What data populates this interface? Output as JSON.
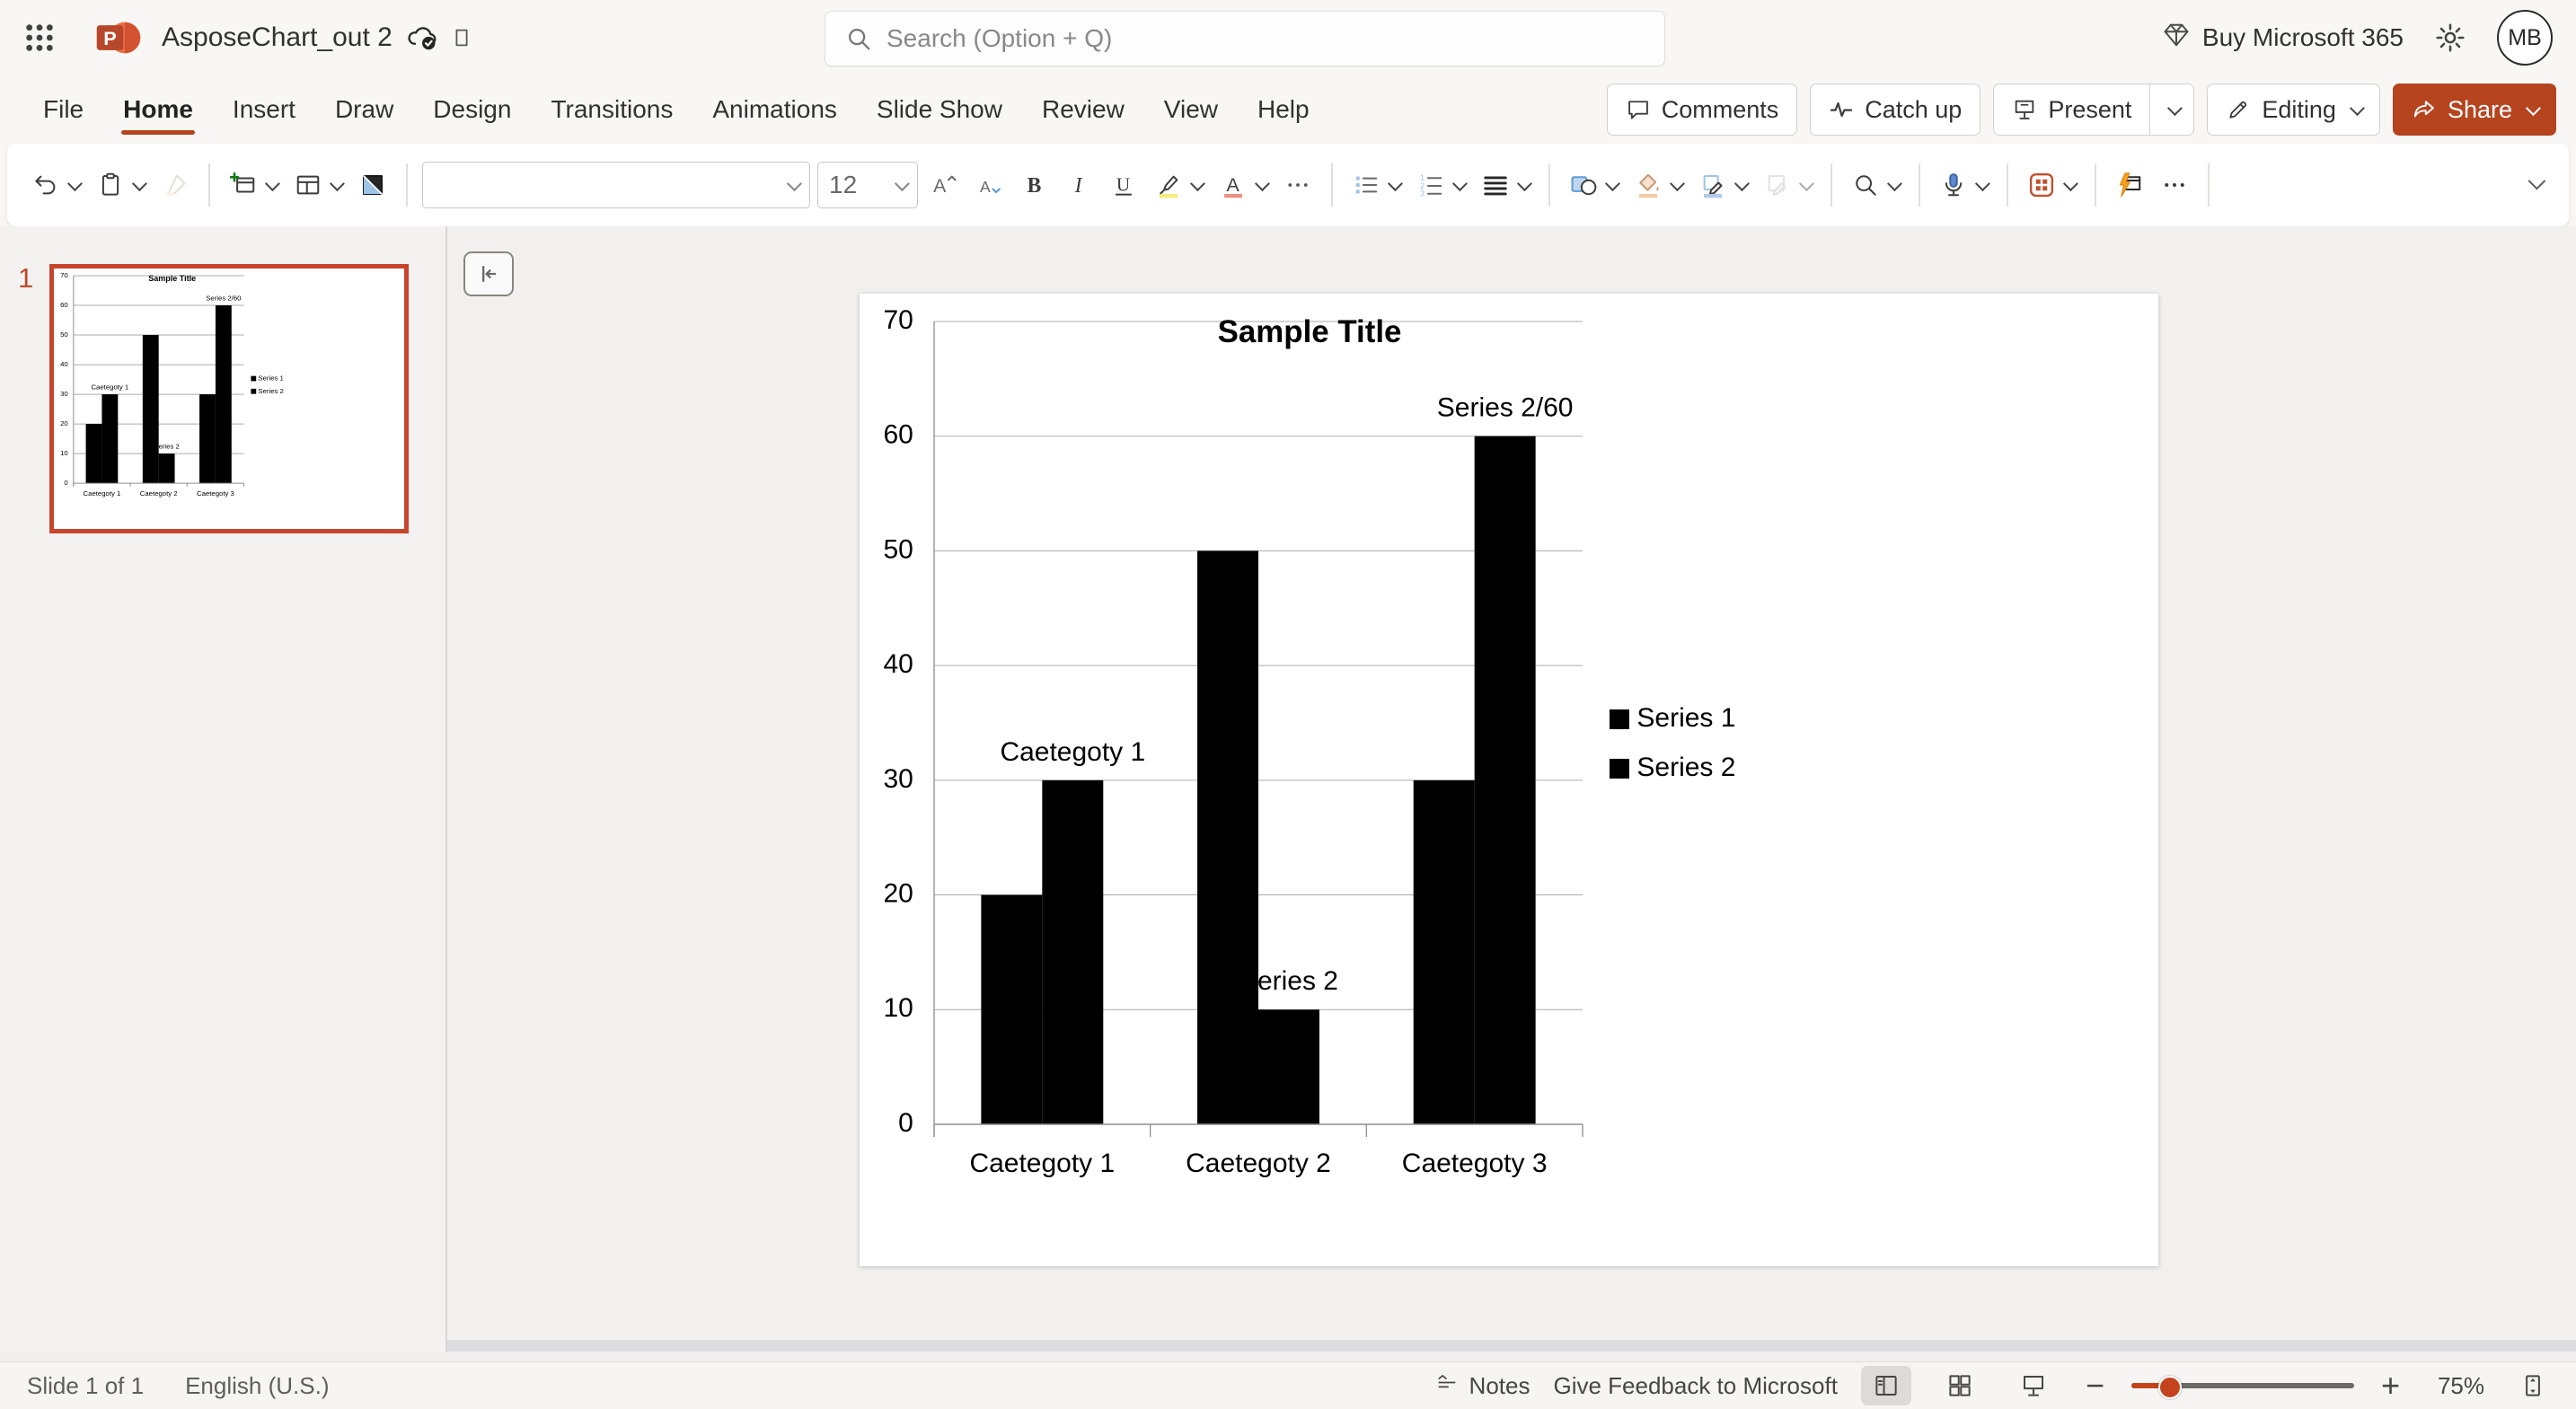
{
  "titlebar": {
    "app": "PowerPoint",
    "document_title": "AsposeChart_out 2",
    "search_placeholder": "Search (Option + Q)",
    "buy_label": "Buy Microsoft 365",
    "avatar_initials": "MB"
  },
  "menubar": {
    "items": [
      {
        "label": "File"
      },
      {
        "label": "Home",
        "active": true
      },
      {
        "label": "Insert"
      },
      {
        "label": "Draw"
      },
      {
        "label": "Design"
      },
      {
        "label": "Transitions"
      },
      {
        "label": "Animations"
      },
      {
        "label": "Slide Show"
      },
      {
        "label": "Review"
      },
      {
        "label": "View"
      },
      {
        "label": "Help"
      }
    ]
  },
  "actions": {
    "buttons": [
      {
        "id": "comments",
        "label": "Comments",
        "icon": "comments"
      },
      {
        "id": "catch-up",
        "label": "Catch up",
        "icon": "catch-up"
      },
      {
        "id": "present",
        "label": "Present",
        "icon": "present",
        "chevron": true,
        "split": true
      },
      {
        "id": "editing",
        "label": "Editing",
        "icon": "editing",
        "chevron": true
      },
      {
        "id": "share",
        "label": "Share",
        "icon": "share",
        "chevron": true,
        "primary": true
      }
    ]
  },
  "toolbar": {
    "font_size": "12",
    "items": [
      {
        "icon": "undo",
        "chevron": true
      },
      {
        "icon": "paste",
        "chevron": true
      },
      {
        "icon": "format-painter",
        "disabled": true
      },
      {
        "divider": true
      },
      {
        "icon": "new-slide",
        "chevron": true
      },
      {
        "icon": "layout",
        "chevron": true
      },
      {
        "icon": "reset-design"
      },
      {
        "divider": true
      },
      {
        "combo": "font-name",
        "chevron": true
      },
      {
        "combo": "font-size",
        "chevron": true
      },
      {
        "icon": "grow-font"
      },
      {
        "icon": "shrink-font"
      },
      {
        "icon": "bold"
      },
      {
        "icon": "italic"
      },
      {
        "icon": "underline"
      },
      {
        "icon": "text-highlight",
        "chevron": true
      },
      {
        "icon": "font-color",
        "chevron": true
      },
      {
        "icon": "more-commands"
      },
      {
        "divider": true
      },
      {
        "icon": "bullets",
        "chevron": true
      },
      {
        "icon": "numbering",
        "chevron": true
      },
      {
        "icon": "align",
        "chevron": true
      },
      {
        "divider": true
      },
      {
        "icon": "shapes",
        "chevron": true
      },
      {
        "icon": "shape-fill",
        "chevron": true
      },
      {
        "icon": "shape-outline",
        "chevron": true
      },
      {
        "icon": "shape-effects",
        "chevron": true,
        "disabled": true
      },
      {
        "divider": true
      },
      {
        "icon": "find",
        "chevron": true
      },
      {
        "divider": true
      },
      {
        "icon": "dictate",
        "chevron": true
      },
      {
        "divider": true
      },
      {
        "icon": "designer",
        "chevron": true
      },
      {
        "divider": true
      },
      {
        "icon": "quick-design"
      },
      {
        "icon": "overflow"
      },
      {
        "divider": true
      }
    ]
  },
  "thumbnail_panel": {
    "slide_number": "1"
  },
  "status_bar": {
    "slide_counter": "Slide 1 of 1",
    "language": "English (U.S.)",
    "notes_label": "Notes",
    "feedback_label": "Give Feedback to Microsoft",
    "zoom_level": "75%"
  },
  "chart_data": {
    "type": "bar",
    "title": "Sample Title",
    "categories": [
      "Caetegoty 1",
      "Caetegoty 2",
      "Caetegoty 3"
    ],
    "series": [
      {
        "name": "Series 1",
        "values": [
          20,
          50,
          30
        ],
        "color": "#000000"
      },
      {
        "name": "Series 2",
        "values": [
          30,
          10,
          60
        ],
        "color": "#000000"
      }
    ],
    "ylim": [
      0,
      70
    ],
    "yticks": [
      0,
      10,
      20,
      30,
      40,
      50,
      60,
      70
    ],
    "grid": true,
    "legend_position": "right",
    "legend_entries": [
      "Series 1",
      "Series 2"
    ],
    "data_labels": [
      {
        "text": "Caetegoty 1",
        "category": 0,
        "series": 1
      },
      {
        "text": "Series 2",
        "category": 1,
        "series": 1
      },
      {
        "text": "Series 2/60",
        "category": 2,
        "series": 1
      }
    ]
  },
  "colors": {
    "accent": "#B5441F",
    "selection_border": "#C8442C",
    "bar": "#000000",
    "highlight_bar": "#F4EC7A",
    "font_color_bar": "#EE8F83",
    "shape_fill_bar": "#F5C9A4",
    "shape_outline_bar": "#AFC9E9",
    "designer": "#C0502F"
  }
}
